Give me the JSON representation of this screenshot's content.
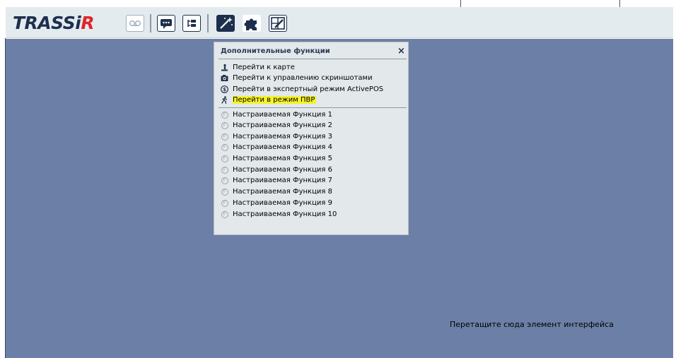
{
  "app": {
    "logo_main": "TRASSi",
    "logo_accent": "R"
  },
  "toolbar": {
    "icons": [
      "voicemail-icon",
      "chat-icon",
      "tree-icon",
      "magic-wand-icon",
      "puzzle-icon",
      "edit-layout-icon"
    ],
    "accent_color": "#1d2f4d"
  },
  "panel": {
    "title": "Дополнительные функции",
    "close_label": "×",
    "main_items": [
      {
        "label": "Перейти к карте",
        "icon": "map-pin-icon"
      },
      {
        "label": "Перейти к управлению скриншотами",
        "icon": "camera-icon"
      },
      {
        "label": "Перейти в экспертный режим ActivePOS",
        "icon": "dollar-circle-icon"
      },
      {
        "label": "Перейти в режим ПВР",
        "icon": "running-man-icon",
        "highlighted": true
      }
    ],
    "custom_items": [
      {
        "label": "Настраиваемая Функция 1",
        "icon": "f-circle-icon"
      },
      {
        "label": "Настраиваемая Функция 2",
        "icon": "f-circle-icon"
      },
      {
        "label": "Настраиваемая Функция 3",
        "icon": "f-circle-icon"
      },
      {
        "label": "Настраиваемая Функция 4",
        "icon": "f-circle-icon"
      },
      {
        "label": "Настраиваемая Функция 5",
        "icon": "f-circle-icon"
      },
      {
        "label": "Настраиваемая Функция 6",
        "icon": "f-circle-icon"
      },
      {
        "label": "Настраиваемая Функция 7",
        "icon": "f-circle-icon"
      },
      {
        "label": "Настраиваемая Функция 8",
        "icon": "f-circle-icon"
      },
      {
        "label": "Настраиваемая Функция 9",
        "icon": "f-circle-icon"
      },
      {
        "label": "Настраиваемая Функция 10",
        "icon": "f-circle-icon"
      }
    ],
    "custom_icon_letter": "F",
    "highlight_color": "#f5f22a"
  },
  "workspace": {
    "drop_hint": "Перетащите сюда элемент интерфейса",
    "background_color": "#6c7fa6"
  }
}
